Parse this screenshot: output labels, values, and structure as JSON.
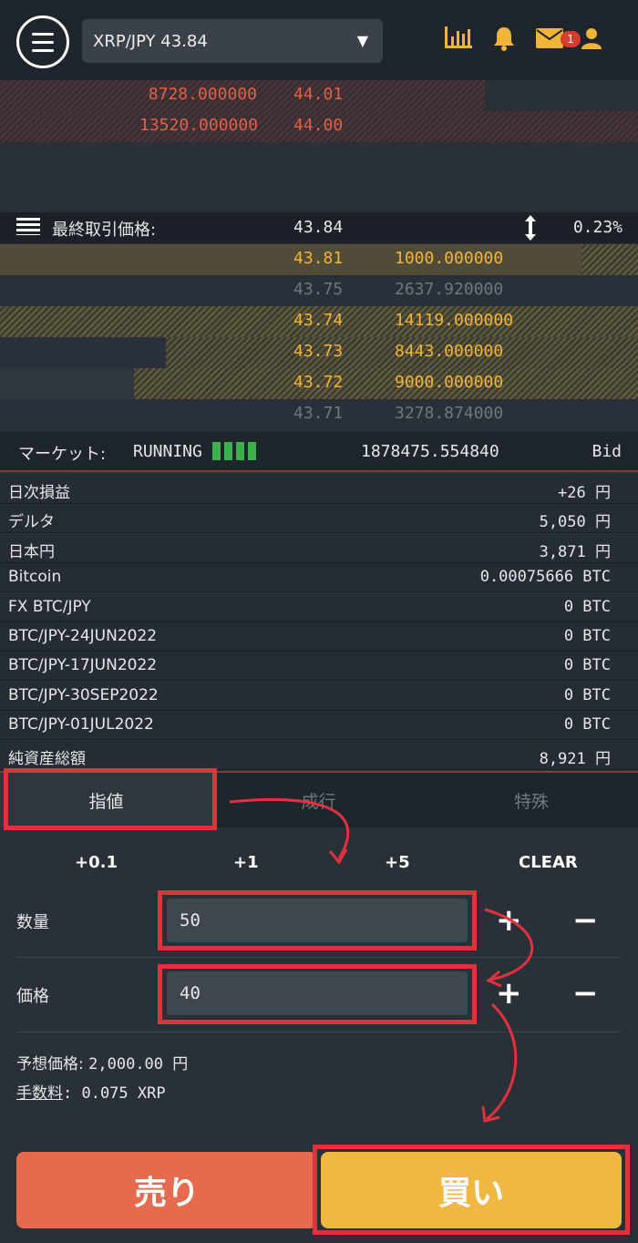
{
  "header": {
    "pair": "XRP/JPY 43.84",
    "caret": "▼",
    "badge": "1"
  },
  "asks": [
    {
      "amount": "8728.000000",
      "price": "44.01"
    },
    {
      "amount": "13520.000000",
      "price": "44.00"
    }
  ],
  "last_trade": {
    "label": "最終取引価格:",
    "price": "43.84",
    "change": "0.23%"
  },
  "bids": [
    {
      "price": "43.81",
      "amount": "1000.000000",
      "depth": 0.09
    },
    {
      "price": "43.75",
      "amount": "2637.920000",
      "depth": 0
    },
    {
      "price": "43.74",
      "amount": "14119.000000",
      "depth": 1.0
    },
    {
      "price": "43.73",
      "amount": "8443.000000",
      "depth": 0.74
    },
    {
      "price": "43.72",
      "amount": "9000.000000",
      "depth": 0.79
    },
    {
      "price": "43.71",
      "amount": "3278.874000",
      "depth": 0
    }
  ],
  "market": {
    "label": "マーケット:",
    "status": "RUNNING",
    "volume": "1878475.554840",
    "side": "Bid"
  },
  "balances": [
    {
      "label": "日次損益",
      "value": "+26 円"
    },
    {
      "label": "デルタ",
      "value": "5,050 円"
    },
    {
      "label": "日本円",
      "value": "3,871 円"
    },
    {
      "label": "Bitcoin",
      "value": "0.00075666 BTC"
    },
    {
      "label": "FX BTC/JPY",
      "value": "0 BTC"
    },
    {
      "label": "BTC/JPY-24JUN2022",
      "value": "0 BTC"
    },
    {
      "label": "BTC/JPY-17JUN2022",
      "value": "0 BTC"
    },
    {
      "label": "BTC/JPY-30SEP2022",
      "value": "0 BTC"
    },
    {
      "label": "BTC/JPY-01JUL2022",
      "value": "0 BTC"
    },
    {
      "label": "純資産総額",
      "value": "8,921 円"
    }
  ],
  "tabs": [
    "指値",
    "成行",
    "特殊"
  ],
  "quick": [
    "+0.1",
    "+1",
    "+5",
    "CLEAR"
  ],
  "form": {
    "qty_label": "数量",
    "qty_value": "50",
    "price_label": "価格",
    "price_value": "40",
    "plus": "+",
    "minus": "−",
    "est_label": "予想価格:",
    "est_value": "2,000.00 円",
    "fee_label": "手数料",
    "fee_value": ": 0.075 XRP"
  },
  "buttons": {
    "sell": "売り",
    "buy": "買い"
  },
  "colors": {
    "ask": "#e0604a",
    "bid": "#f0b43a",
    "sell": "#e56a4e",
    "buy": "#f0b843",
    "highlight": "#e0323c",
    "running": "#3cb04a"
  }
}
